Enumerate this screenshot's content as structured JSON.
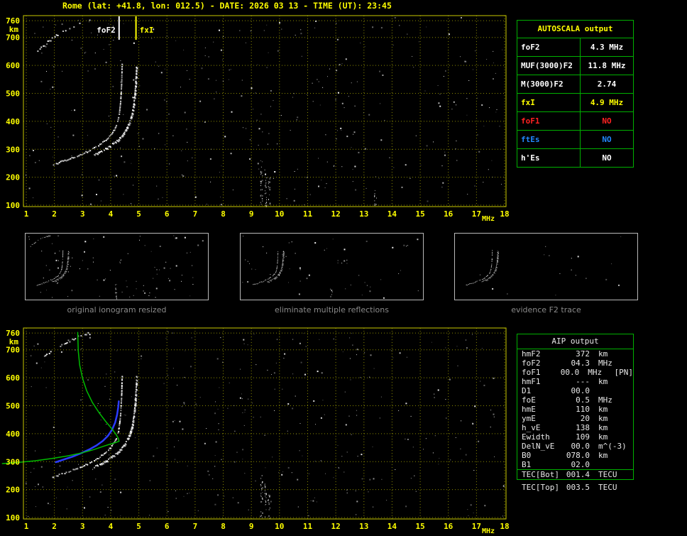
{
  "window": {
    "title": "Rome (lat: +41.8, lon: 012.5) - DATE: 2026 03 13 - TIME (UT): 23:45"
  },
  "colors": {
    "accent_yellow": "#ffff00",
    "border_yellow": "#c8c800",
    "grid_yellow": "#8a8a00",
    "table_green": "#00b000",
    "profile_green": "#00bb00",
    "restored_blue": "#2b3cff",
    "status_red": "#ff2222",
    "status_blue": "#2288ff",
    "echo_white": "#ffffff",
    "caption_gray": "#8a8a8a"
  },
  "autoscala_table": {
    "header": "AUTOSCALA output",
    "rows": [
      {
        "label": "foF2",
        "value": "4.3 MHz",
        "color": "#ffffff"
      },
      {
        "label": "MUF(3000)F2",
        "value": "11.8 MHz",
        "color": "#ffffff"
      },
      {
        "label": "M(3000)F2",
        "value": "2.74",
        "color": "#ffffff"
      },
      {
        "label": "fxI",
        "value": "4.9 MHz",
        "color": "#ffff00"
      },
      {
        "label": "foF1",
        "value": "NO",
        "color": "#ff2222"
      },
      {
        "label": "ftEs",
        "value": "NO",
        "color": "#2288ff"
      },
      {
        "label": "h'Es",
        "value": "NO",
        "color": "#ffffff"
      }
    ]
  },
  "aip_table": {
    "header": "AIP output",
    "rows": [
      {
        "label": "hmF2",
        "value": "372",
        "unit": "km",
        "extra": ""
      },
      {
        "label": "foF2",
        "value": "04.3",
        "unit": "MHz",
        "extra": ""
      },
      {
        "label": "foF1",
        "value": "00.0",
        "unit": "MHz",
        "extra": "[PN]"
      },
      {
        "label": "hmF1",
        "value": "---",
        "unit": "km",
        "extra": ""
      },
      {
        "label": "D1",
        "value": "00.0",
        "unit": "",
        "extra": ""
      },
      {
        "label": "foE",
        "value": "0.5",
        "unit": "MHz",
        "extra": ""
      },
      {
        "label": "hmE",
        "value": "110",
        "unit": "km",
        "extra": ""
      },
      {
        "label": "ymE",
        "value": "20",
        "unit": "km",
        "extra": ""
      },
      {
        "label": "h_vE",
        "value": "138",
        "unit": "km",
        "extra": ""
      },
      {
        "label": "Ewidth",
        "value": "109",
        "unit": "km",
        "extra": ""
      },
      {
        "label": "DelN_vE",
        "value": "00.0",
        "unit": "m^(-3)",
        "extra": ""
      },
      {
        "label": "B0",
        "value": "078.0",
        "unit": "km",
        "extra": ""
      },
      {
        "label": "B1",
        "value": "02.0",
        "unit": "",
        "extra": ""
      }
    ],
    "tec_rows": [
      {
        "label": "TEC[Bot]",
        "value": "001.4",
        "unit": "TECU"
      },
      {
        "label": "TEC[Top]",
        "value": "003.5",
        "unit": "TECU"
      }
    ]
  },
  "thumbnails": [
    {
      "caption": "original ionogram resized"
    },
    {
      "caption": "eliminate multiple reflections"
    },
    {
      "caption": "evidence F2 trace"
    }
  ],
  "chart_data": [
    {
      "id": "main_ionogram",
      "type": "scatter",
      "title": "ionogram echoes, virtual height vs sounding frequency",
      "xlabel": "MHz",
      "ylabel": "km",
      "xlim": [
        0.9,
        18.05
      ],
      "ylim": [
        95,
        778
      ],
      "x_ticks": [
        1,
        2,
        3,
        4,
        5,
        6,
        7,
        8,
        9,
        10,
        11,
        12,
        13,
        14,
        15,
        16,
        17,
        18
      ],
      "y_ticks": [
        100,
        200,
        300,
        400,
        500,
        600,
        700,
        760
      ],
      "grid": true,
      "legend": "none",
      "markers": [
        {
          "label": "foF2",
          "freq": 4.3,
          "color": "#ffffff"
        },
        {
          "label": "fxI",
          "freq": 4.9,
          "color": "#ffff00"
        }
      ],
      "noise": {
        "seed": 42,
        "count": 340
      },
      "streaks": [
        {
          "f": 9.35,
          "km": [
            97,
            262
          ],
          "n": 26
        },
        {
          "f": 9.5,
          "km": [
            97,
            232
          ],
          "n": 20
        },
        {
          "f": 9.62,
          "km": [
            97,
            205
          ],
          "n": 14
        },
        {
          "f": 13.4,
          "km": [
            97,
            160
          ],
          "n": 8
        }
      ],
      "series": [
        {
          "name": "f2-trace-ordinary",
          "color": "#ffffff",
          "render": "dots",
          "points": [
            [
              1.95,
              247
            ],
            [
              2.15,
              255
            ],
            [
              2.35,
              262
            ],
            [
              2.55,
              269
            ],
            [
              2.75,
              277
            ],
            [
              2.95,
              285
            ],
            [
              3.15,
              294
            ],
            [
              3.35,
              304
            ],
            [
              3.55,
              316
            ],
            [
              3.75,
              330
            ],
            [
              3.9,
              343
            ],
            [
              4.02,
              357
            ],
            [
              4.12,
              373
            ],
            [
              4.2,
              391
            ],
            [
              4.26,
              413
            ],
            [
              4.3,
              440
            ],
            [
              4.33,
              470
            ],
            [
              4.35,
              505
            ],
            [
              4.37,
              548
            ],
            [
              4.38,
              592
            ],
            [
              4.39,
              615
            ]
          ]
        },
        {
          "name": "f2-trace-extraordinary",
          "color": "#ffffff",
          "render": "dots",
          "bold": true,
          "points": [
            [
              3.4,
              284
            ],
            [
              3.6,
              293
            ],
            [
              3.8,
              304
            ],
            [
              4.0,
              317
            ],
            [
              4.2,
              332
            ],
            [
              4.38,
              350
            ],
            [
              4.53,
              372
            ],
            [
              4.65,
              398
            ],
            [
              4.74,
              428
            ],
            [
              4.8,
              462
            ],
            [
              4.84,
              500
            ],
            [
              4.87,
              542
            ],
            [
              4.89,
              580
            ],
            [
              4.9,
              610
            ]
          ]
        },
        {
          "name": "multiple-reflection-trace",
          "color": "#ffffff",
          "render": "dots",
          "sparse": true,
          "points": [
            [
              1.35,
              652
            ],
            [
              1.55,
              670
            ],
            [
              1.75,
              686
            ],
            [
              1.95,
              701
            ],
            [
              2.15,
              714
            ],
            [
              2.38,
              727
            ],
            [
              2.62,
              739
            ],
            [
              2.88,
              750
            ],
            [
              3.12,
              758
            ],
            [
              3.35,
              764
            ]
          ]
        }
      ]
    },
    {
      "id": "thumb_original",
      "type": "scatter",
      "title": "original ionogram resized",
      "xlim": [
        0.9,
        18.05
      ],
      "ylim": [
        95,
        778
      ],
      "grid": false,
      "noise": {
        "seed": 7,
        "count": 90
      },
      "streaks": [
        {
          "f": 9.4,
          "km": [
            97,
            255
          ],
          "n": 9
        }
      ],
      "series_ref": {
        "chart": "main_ionogram",
        "names": [
          "f2-trace-ordinary",
          "f2-trace-extraordinary",
          "multiple-reflection-trace"
        ]
      }
    },
    {
      "id": "thumb_filtered",
      "type": "scatter",
      "title": "eliminate multiple reflections",
      "xlim": [
        0.9,
        18.05
      ],
      "ylim": [
        95,
        778
      ],
      "grid": false,
      "noise": {
        "seed": 8,
        "count": 55
      },
      "streaks": [
        {
          "f": 9.4,
          "km": [
            97,
            220
          ],
          "n": 6
        }
      ],
      "series_ref": {
        "chart": "main_ionogram",
        "names": [
          "f2-trace-ordinary",
          "f2-trace-extraordinary"
        ]
      }
    },
    {
      "id": "thumb_f2",
      "type": "scatter",
      "title": "evidence F2 trace",
      "xlim": [
        0.9,
        18.05
      ],
      "ylim": [
        95,
        778
      ],
      "grid": false,
      "noise": {
        "seed": 9,
        "count": 18
      },
      "streaks": [],
      "series_ref": {
        "chart": "main_ionogram",
        "names": [
          "f2-trace-ordinary",
          "f2-trace-extraordinary"
        ]
      }
    },
    {
      "id": "bottom_ionogram",
      "type": "scatter",
      "title": "ionogram with restored F2 trace and electron density profile",
      "xlabel": "MHz",
      "ylabel": "km",
      "xlim": [
        0.9,
        18.05
      ],
      "ylim": [
        95,
        778
      ],
      "x_ticks": [
        1,
        2,
        3,
        4,
        5,
        6,
        7,
        8,
        9,
        10,
        11,
        12,
        13,
        14,
        15,
        16,
        17,
        18
      ],
      "y_ticks": [
        100,
        200,
        300,
        400,
        500,
        600,
        700,
        760
      ],
      "grid": true,
      "noise": {
        "seed": 99,
        "count": 320
      },
      "streaks": [
        {
          "f": 9.35,
          "km": [
            97,
            262
          ],
          "n": 24
        },
        {
          "f": 9.5,
          "km": [
            97,
            225
          ],
          "n": 18
        },
        {
          "f": 9.62,
          "km": [
            97,
            200
          ],
          "n": 12
        }
      ],
      "series_ref": {
        "chart": "main_ionogram",
        "names": [
          "f2-trace-ordinary",
          "f2-trace-extraordinary",
          "multiple-reflection-trace"
        ]
      },
      "series": [
        {
          "name": "restored-f2-trace",
          "color": "#2b3cff",
          "render": "line",
          "width": 2.5,
          "points": [
            [
              2.05,
              298
            ],
            [
              2.35,
              308
            ],
            [
              2.65,
              318
            ],
            [
              2.95,
              330
            ],
            [
              3.25,
              344
            ],
            [
              3.5,
              358
            ],
            [
              3.72,
              374
            ],
            [
              3.9,
              392
            ],
            [
              4.05,
              414
            ],
            [
              4.16,
              440
            ],
            [
              4.23,
              468
            ],
            [
              4.27,
              495
            ],
            [
              4.29,
              516
            ]
          ]
        },
        {
          "name": "electron-density-profile",
          "color": "#00bb00",
          "render": "line",
          "width": 1.5,
          "points": [
            [
              0.15,
              293
            ],
            [
              0.7,
              297
            ],
            [
              1.3,
              303
            ],
            [
              1.9,
              311
            ],
            [
              2.5,
              321
            ],
            [
              3.0,
              332
            ],
            [
              3.4,
              343
            ],
            [
              3.75,
              355
            ],
            [
              4.0,
              363
            ],
            [
              4.2,
              369
            ],
            [
              4.3,
              373
            ],
            [
              4.27,
              384
            ],
            [
              4.18,
              399
            ],
            [
              4.03,
              419
            ],
            [
              3.82,
              444
            ],
            [
              3.58,
              476
            ],
            [
              3.35,
              512
            ],
            [
              3.15,
              553
            ],
            [
              3.0,
              598
            ],
            [
              2.9,
              645
            ],
            [
              2.85,
              695
            ],
            [
              2.83,
              762
            ]
          ]
        }
      ]
    }
  ]
}
